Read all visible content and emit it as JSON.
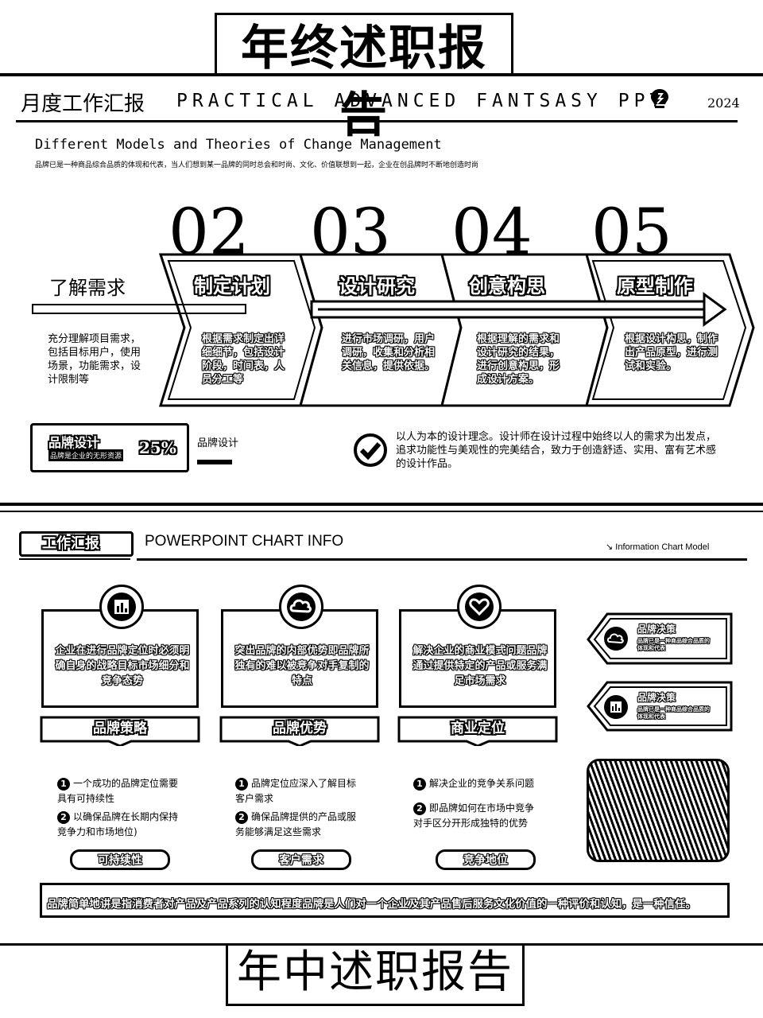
{
  "top_title": "年终述职报告",
  "header": {
    "cn": "月度工作汇报",
    "en": "PRACTICAL ADVANCED FANTSASY PPT",
    "year": "2024",
    "icon": "lightbulb-icon"
  },
  "subtitle": {
    "en": "Different Models and Theories of Change Management",
    "cn": "品牌已是一种商品综合品质的体现和代表，当人们想到某一品牌的同时总会和时尚、文化、价值联想到一起，企业在创品牌时不断地创造时尚"
  },
  "steps": [
    {
      "num": "",
      "title": "了解需求",
      "desc": "充分理解项目需求，包括目标用户，使用场景，功能需求，设计限制等"
    },
    {
      "num": "02",
      "title": "制定计划",
      "desc": "根据需求制定出详细细节，包括设计阶段，时间表，人员分工等"
    },
    {
      "num": "03",
      "title": "设计研究",
      "desc": "进行市场调研，用户调研，收集和分析相关信息，提供依据。"
    },
    {
      "num": "04",
      "title": "创意构思",
      "desc": "根据理解的需求和设计研究的结果，进行创意构思，形成设计方案。"
    },
    {
      "num": "05",
      "title": "原型制作",
      "desc": "根据设计构思，制作出产品原型，进行测试和实验。"
    }
  ],
  "brand": {
    "name": "品牌设计",
    "tag": "品牌是企业的无形资源",
    "percent": "25%",
    "small_label": "品牌设计",
    "check_text": "以人为本的设计理念。设计师在设计过程中始终以人的需求为出发点，追求功能性与美观性的完美结合，致力于创造舒适、实用、富有艺术感的设计作品。"
  },
  "section2": {
    "label": "工作汇报",
    "title": "POWERPOINT CHART INFO",
    "info": "↘ Information Chart Model",
    "cards": [
      {
        "icon": "bar-chart-icon",
        "text": "企业在进行品牌定位时必须明确自身的战略目标市场细分和竞争态势",
        "label": "品牌策略",
        "bullets": [
          "一个成功的品牌定位需要具有可持续性",
          "以确保品牌在长期内保持竞争力和市场地位)"
        ],
        "pill": "可持续性"
      },
      {
        "icon": "cloud-icon",
        "text": "突出品牌的内部优势即品牌所独有的难以被竞争对手复制的特点",
        "label": "品牌优势",
        "bullets": [
          "品牌定位应深入了解目标客户需求",
          "确保品牌提供的产品或服务能够满足这些需求"
        ],
        "pill": "客户需求"
      },
      {
        "icon": "heart-icon",
        "text": "解决企业的商业模式问题品牌通过提供特定的产品或服务满足市场需求",
        "label": "商业定位",
        "bullets": [
          "解决企业的竞争关系问题",
          "即品牌如何在市场中竞争对手区分开形成独特的优势"
        ],
        "pill": "竞争地位"
      }
    ],
    "side": [
      {
        "icon": "cloud-icon",
        "title": "品牌决策",
        "desc": "品牌已是一种商品综合品质的体现和代表"
      },
      {
        "icon": "bar-chart-icon",
        "title": "品牌决策",
        "desc": "品牌已是一种商品综合品质的体现和代表"
      }
    ],
    "banner": "品牌简单地讲是指消费者对产品及产品系列的认知程度品牌是人们对一个企业及其产品售后服务文化价值的一种评价和认知，是一种信任。"
  },
  "bottom_title": "年中述职报告"
}
